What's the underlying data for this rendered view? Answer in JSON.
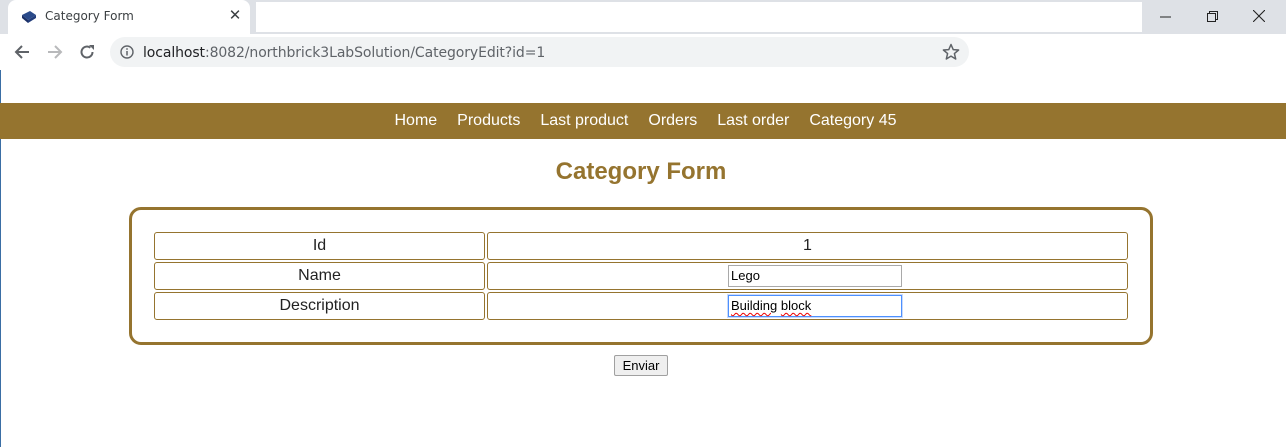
{
  "browser": {
    "tab_title": "Category Form",
    "url_host": "localhost",
    "url_rest": ":8082/northbrick3LabSolution/CategoryEdit?id=1"
  },
  "nav": {
    "items": [
      "Home",
      "Products",
      "Last product",
      "Orders",
      "Last order",
      "Category 45"
    ]
  },
  "form": {
    "title": "Category Form",
    "id_label": "Id",
    "id_value": "1",
    "name_label": "Name",
    "name_value": "Lego",
    "description_label": "Description",
    "description_value_word1": "Building",
    "description_value_word2": "block",
    "submit_label": "Enviar"
  },
  "colors": {
    "accent": "#95742f",
    "tab_strip": "#dee1e6",
    "omnibox": "#f1f3f4"
  }
}
